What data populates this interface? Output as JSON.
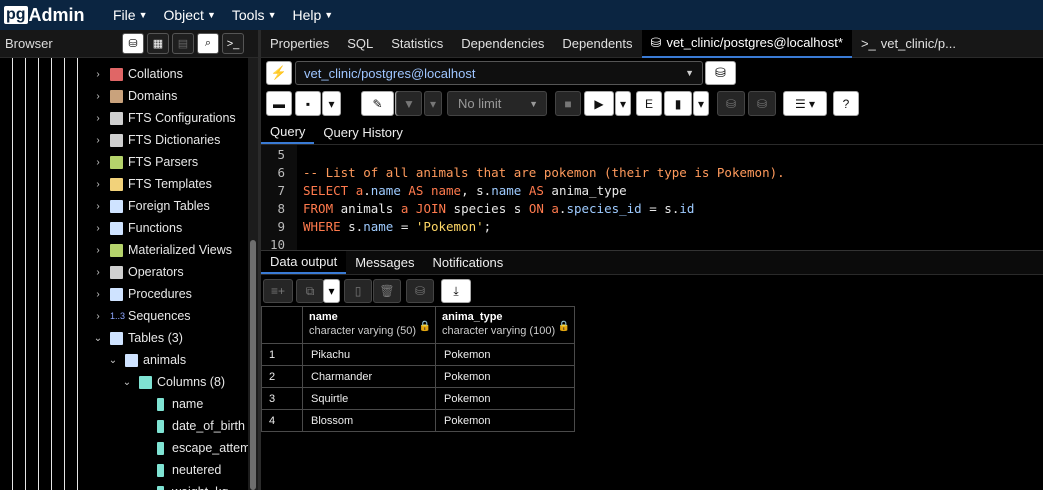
{
  "app": {
    "logo_pg": "pg",
    "logo_admin": "Admin"
  },
  "menu": [
    {
      "label": "File"
    },
    {
      "label": "Object"
    },
    {
      "label": "Tools"
    },
    {
      "label": "Help"
    }
  ],
  "browser": {
    "title": "Browser",
    "tree": [
      {
        "label": "Collations",
        "icon": "collation-icon",
        "color": "#e06666"
      },
      {
        "label": "Domains",
        "icon": "domain-icon",
        "color": "#c9a27c"
      },
      {
        "label": "FTS Configurations",
        "icon": "fts-config-icon",
        "color": "#cfcfcf"
      },
      {
        "label": "FTS Dictionaries",
        "icon": "fts-dictionary-icon",
        "color": "#cfcfcf"
      },
      {
        "label": "FTS Parsers",
        "icon": "fts-parser-icon",
        "color": "#b5d36b"
      },
      {
        "label": "FTS Templates",
        "icon": "fts-template-icon",
        "color": "#f2d27a"
      },
      {
        "label": "Foreign Tables",
        "icon": "foreign-table-icon",
        "color": "#cfe3ff"
      },
      {
        "label": "Functions",
        "icon": "function-icon",
        "color": "#cfe3ff"
      },
      {
        "label": "Materialized Views",
        "icon": "materialized-view-icon",
        "color": "#b5d36b"
      },
      {
        "label": "Operators",
        "icon": "operator-icon",
        "color": "#cfcfcf"
      },
      {
        "label": "Procedures",
        "icon": "procedure-icon",
        "color": "#cfe3ff"
      },
      {
        "label": "Sequences",
        "icon": "sequence-icon",
        "color": "#8fa8ff",
        "glyph": "1..3"
      },
      {
        "label": "Tables (3)",
        "icon": "tables-icon",
        "color": "#cfe3ff"
      },
      {
        "label": "animals",
        "icon": "table-icon",
        "color": "#cfe3ff"
      },
      {
        "label": "Columns (8)",
        "icon": "columns-icon",
        "color": "#7fe3d3"
      },
      {
        "label": "name",
        "icon": "column-icon",
        "color": "#7fe3d3"
      },
      {
        "label": "date_of_birth",
        "icon": "column-icon",
        "color": "#7fe3d3"
      },
      {
        "label": "escape_attemp",
        "icon": "column-icon",
        "color": "#7fe3d3"
      },
      {
        "label": "neutered",
        "icon": "column-icon",
        "color": "#7fe3d3"
      },
      {
        "label": "weight_kg",
        "icon": "column-icon",
        "color": "#7fe3d3"
      }
    ]
  },
  "tabs": [
    {
      "label": "Properties"
    },
    {
      "label": "SQL"
    },
    {
      "label": "Statistics"
    },
    {
      "label": "Dependencies"
    },
    {
      "label": "Dependents"
    },
    {
      "label": "vet_clinic/postgres@localhost*",
      "icon": "database-icon"
    },
    {
      "label": "vet_clinic/p...",
      "icon": "terminal-icon"
    }
  ],
  "query_tool": {
    "connection": "vet_clinic/postgres@localhost",
    "limit": "No limit",
    "tabs": [
      "Query",
      "Query History"
    ],
    "lines": [
      {
        "n": "5",
        "tokens": []
      },
      {
        "n": "6",
        "tokens": [
          {
            "c": "cm",
            "t": "-- List of all animals that are pokemon (their type is Pokemon)."
          }
        ]
      },
      {
        "n": "7",
        "tokens": [
          {
            "c": "kw",
            "t": "SELECT "
          },
          {
            "c": "kw",
            "t": "a"
          },
          {
            "c": "txt",
            "t": "."
          },
          {
            "c": "fld",
            "t": "name"
          },
          {
            "c": "kw",
            "t": " AS "
          },
          {
            "c": "kw",
            "t": "name"
          },
          {
            "c": "txt",
            "t": ", "
          },
          {
            "c": "txt",
            "t": "s"
          },
          {
            "c": "txt",
            "t": "."
          },
          {
            "c": "fld",
            "t": "name"
          },
          {
            "c": "kw",
            "t": " AS "
          },
          {
            "c": "txt",
            "t": "anima_type"
          }
        ]
      },
      {
        "n": "8",
        "tokens": [
          {
            "c": "kw",
            "t": "FROM "
          },
          {
            "c": "txt",
            "t": "animals "
          },
          {
            "c": "kw",
            "t": "a"
          },
          {
            "c": "kw",
            "t": " JOIN "
          },
          {
            "c": "txt",
            "t": "species s "
          },
          {
            "c": "kw",
            "t": "ON "
          },
          {
            "c": "kw",
            "t": "a"
          },
          {
            "c": "txt",
            "t": "."
          },
          {
            "c": "fld",
            "t": "species_id"
          },
          {
            "c": "txt",
            "t": " = s."
          },
          {
            "c": "fld",
            "t": "id"
          }
        ]
      },
      {
        "n": "9",
        "tokens": [
          {
            "c": "kw",
            "t": "WHERE "
          },
          {
            "c": "txt",
            "t": "s."
          },
          {
            "c": "fld",
            "t": "name"
          },
          {
            "c": "txt",
            "t": " = "
          },
          {
            "c": "str",
            "t": "'Pokemon'"
          },
          {
            "c": "txt",
            "t": ";"
          }
        ]
      },
      {
        "n": "10",
        "tokens": []
      }
    ]
  },
  "output": {
    "tabs": [
      "Data output",
      "Messages",
      "Notifications"
    ],
    "columns": [
      {
        "name": "name",
        "type": "character varying (50)"
      },
      {
        "name": "anima_type",
        "type": "character varying (100)"
      }
    ],
    "rows": [
      {
        "n": "1",
        "values": [
          "Pikachu",
          "Pokemon"
        ]
      },
      {
        "n": "2",
        "values": [
          "Charmander",
          "Pokemon"
        ]
      },
      {
        "n": "3",
        "values": [
          "Squirtle",
          "Pokemon"
        ]
      },
      {
        "n": "4",
        "values": [
          "Blossom",
          "Pokemon"
        ]
      }
    ]
  }
}
